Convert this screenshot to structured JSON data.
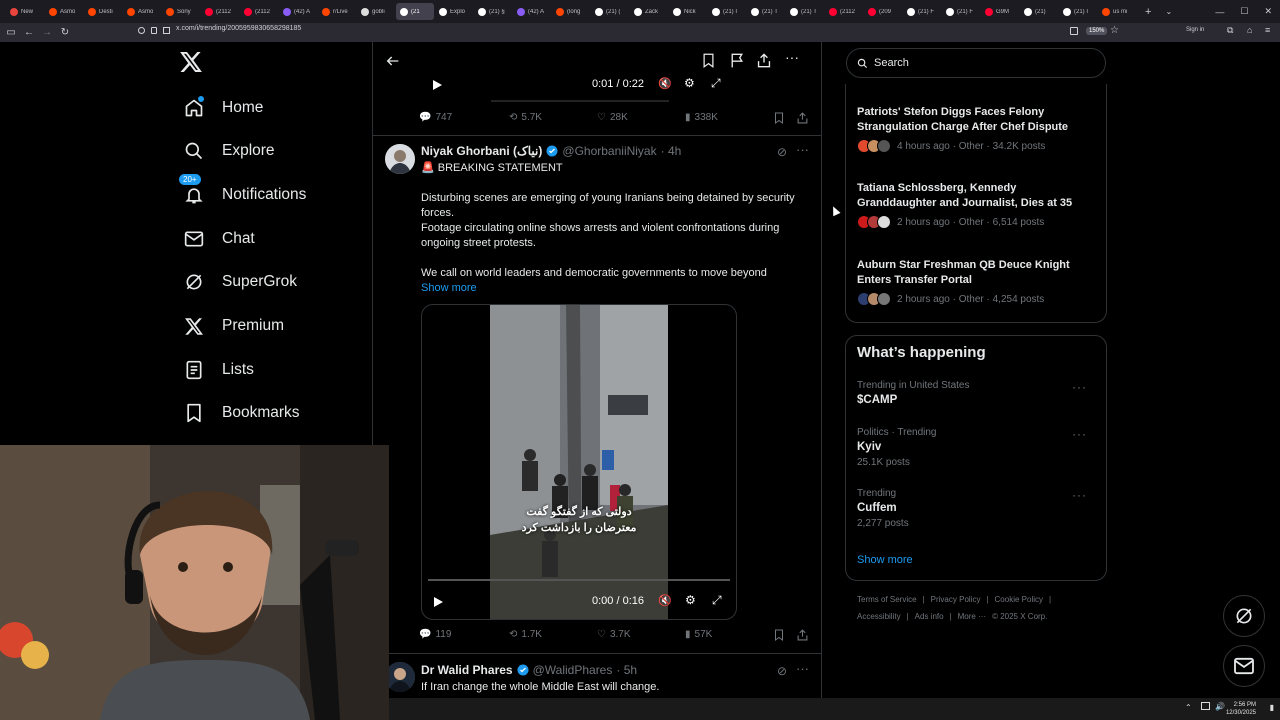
{
  "browser": {
    "tabs": [
      {
        "label": "New",
        "color": "#e8453c"
      },
      {
        "label": "Asmo",
        "color": "#ff4500"
      },
      {
        "label": "Desti",
        "color": "#ff4500"
      },
      {
        "label": "Asmo",
        "color": "#ff4500"
      },
      {
        "label": "Sony",
        "color": "#ff4500"
      },
      {
        "label": "(2112",
        "color": "#ff0033"
      },
      {
        "label": "(2112",
        "color": "#ff0033"
      },
      {
        "label": "(42) A",
        "color": "#8a5cf6"
      },
      {
        "label": "r/Live",
        "color": "#ff4500"
      },
      {
        "label": "gobli",
        "color": "#dddddd"
      },
      {
        "label": "(21",
        "color": "#ffffff"
      },
      {
        "label": "Explo",
        "color": "#ffffff"
      },
      {
        "label": "(21) §",
        "color": "#ffffff"
      },
      {
        "label": "(42) A",
        "color": "#8a5cf6"
      },
      {
        "label": "(long",
        "color": "#ff4500"
      },
      {
        "label": "(21) (",
        "color": "#ffffff"
      },
      {
        "label": "Zack",
        "color": "#ffffff"
      },
      {
        "label": "Nick",
        "color": "#ffffff"
      },
      {
        "label": "(21) I",
        "color": "#ffffff"
      },
      {
        "label": "(21) T",
        "color": "#ffffff"
      },
      {
        "label": "(21) T",
        "color": "#ffffff"
      },
      {
        "label": "(2112",
        "color": "#ff0033"
      },
      {
        "label": "(209",
        "color": "#ff0033"
      },
      {
        "label": "(21) F",
        "color": "#ffffff"
      },
      {
        "label": "(21) F",
        "color": "#ffffff"
      },
      {
        "label": "G9M",
        "color": "#ff0033"
      },
      {
        "label": "(21) ",
        "color": "#ffffff"
      },
      {
        "label": "(21) I",
        "color": "#ffffff"
      },
      {
        "label": "us mi",
        "color": "#ff4500"
      }
    ],
    "active_tab_index": 10,
    "url": "x.com/i/trending/2005959830658298185",
    "zoom": "150%",
    "sign_in": "Sign in"
  },
  "nav": {
    "items": [
      {
        "label": "Home",
        "icon": "home-icon"
      },
      {
        "label": "Explore",
        "icon": "search-icon"
      },
      {
        "label": "Notifications",
        "icon": "bell-icon",
        "badge": "20+"
      },
      {
        "label": "Chat",
        "icon": "mail-icon"
      },
      {
        "label": "SuperGrok",
        "icon": "grok-icon"
      },
      {
        "label": "Premium",
        "icon": "x-icon"
      },
      {
        "label": "Lists",
        "icon": "list-icon"
      },
      {
        "label": "Bookmarks",
        "icon": "bookmark-icon"
      }
    ]
  },
  "top_post": {
    "video_time": "0:01 / 0:22",
    "stats": {
      "replies": "747",
      "reposts": "5.7K",
      "likes": "28K",
      "views": "338K"
    }
  },
  "post": {
    "name": "Niyak Ghorbani (نیاک)",
    "handle": "@GhorbaniiNiyak",
    "time": "· 4h",
    "line1": "🚨 BREAKING STATEMENT",
    "para1": "Disturbing scenes are emerging of young Iranians being detained by security forces.",
    "para2": "Footage circulating online shows arrests and violent confrontations during ongoing street protests.",
    "para3": "We call on world leaders and democratic governments to move beyond",
    "show_more": "Show more",
    "video_caption_1": "دولتی که از گفتگو گفت",
    "video_caption_2": "معترضان را بازداشت کرد",
    "video_time": "0:00 / 0:16",
    "stats": {
      "replies": "119",
      "reposts": "1.7K",
      "likes": "3.7K",
      "views": "57K"
    }
  },
  "post2": {
    "name": "Dr Walid Phares",
    "handle": "@WalidPhares",
    "time": "· 5h",
    "text": "If Iran change the whole Middle East will change."
  },
  "sidebar": {
    "search_placeholder": "Search",
    "news": [
      {
        "title": "Patriots' Stefon Diggs Faces Felony Strangulation Charge After Chef Dispute",
        "meta": "4 hours ago · Other · 34.2K posts"
      },
      {
        "title": "Tatiana Schlossberg, Kennedy Granddaughter and Journalist, Dies at 35",
        "meta": "2 hours ago · Other · 6,514 posts"
      },
      {
        "title": "Auburn Star Freshman QB Deuce Knight Enters Transfer Portal",
        "meta": "2 hours ago · Other · 4,254 posts"
      }
    ],
    "whats_happening": "What’s happening",
    "trends": [
      {
        "context": "Trending in United States",
        "name": "$CAMP",
        "count": ""
      },
      {
        "context": "Politics · Trending",
        "name": "Kyiv",
        "count": "25.1K posts"
      },
      {
        "context": "Trending",
        "name": "Cuffem",
        "count": "2,277 posts"
      }
    ],
    "show_more": "Show more",
    "footer": [
      "Terms of Service",
      "|",
      "Privacy Policy",
      "|",
      "Cookie Policy",
      "|",
      "Accessibility",
      "|",
      "Ads info",
      "|",
      "More ···",
      "© 2025 X Corp."
    ]
  },
  "taskbar": {
    "time": "2:56 PM",
    "date": "12/30/2025"
  },
  "colors": {
    "accent": "#1d9bf0",
    "background": "#000000",
    "border": "#2f3336",
    "muted_text": "#71767b"
  }
}
